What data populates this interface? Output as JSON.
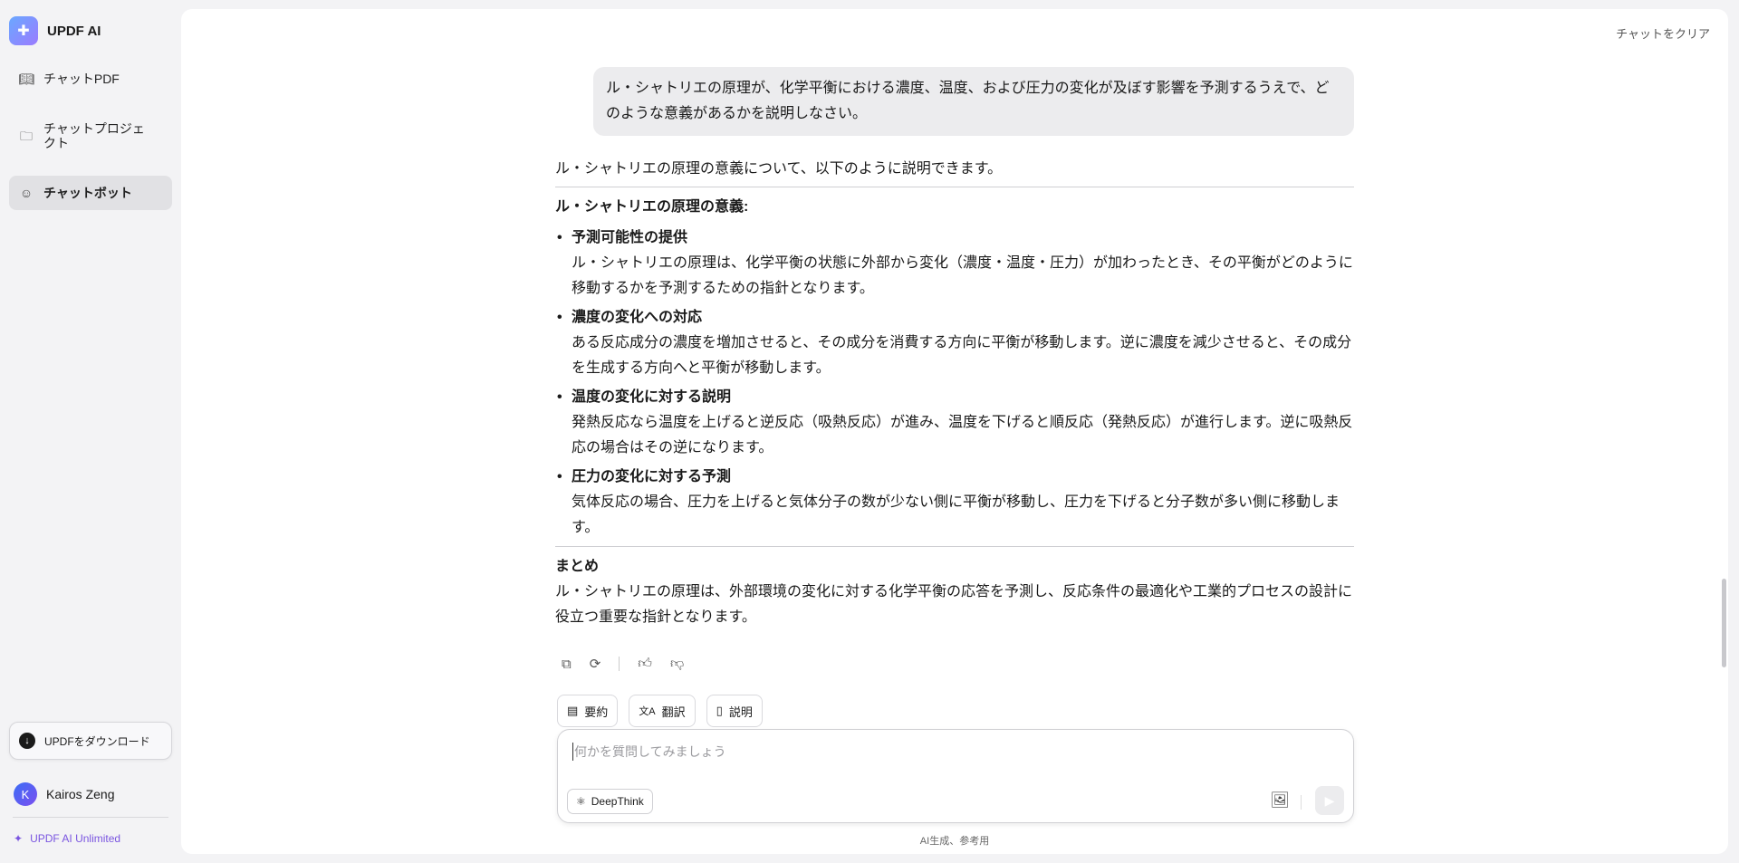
{
  "app": {
    "name": "UPDF AI"
  },
  "sidebar": {
    "items": [
      {
        "label": "チャットPDF",
        "icon": "book-icon"
      },
      {
        "label": "チャットプロジェクト",
        "icon": "folder-icon"
      },
      {
        "label": "チャットボット",
        "icon": "bot-icon"
      }
    ],
    "download_label": "UPDFをダウンロード",
    "user": {
      "initial": "K",
      "name": "Kairos Zeng"
    },
    "plan": "UPDF AI Unlimited"
  },
  "header": {
    "clear_label": "チャットをクリア"
  },
  "chat": {
    "user_message": "ル・シャトリエの原理が、化学平衡における濃度、温度、および圧力の変化が及ぼす影響を予測するうえで、どのような意義があるかを説明しなさい。",
    "intro": "ル・シャトリエの原理の意義について、以下のように説明できます。",
    "heading": "ル・シャトリエの原理の意義:",
    "points": [
      {
        "title": "予測可能性の提供",
        "body": "ル・シャトリエの原理は、化学平衡の状態に外部から変化（濃度・温度・圧力）が加わったとき、その平衡がどのように移動するかを予測するための指針となります。"
      },
      {
        "title": "濃度の変化への対応",
        "body": "ある反応成分の濃度を増加させると、その成分を消費する方向に平衡が移動します。逆に濃度を減少させると、その成分を生成する方向へと平衡が移動します。"
      },
      {
        "title": "温度の変化に対する説明",
        "body": "発熱反応なら温度を上げると逆反応（吸熱反応）が進み、温度を下げると順反応（発熱反応）が進行します。逆に吸熱反応の場合はその逆になります。"
      },
      {
        "title": "圧力の変化に対する予測",
        "body": "気体反応の場合、圧力を上げると気体分子の数が少ない側に平衡が移動し、圧力を下げると分子数が多い側に移動します。"
      }
    ],
    "summary_title": "まとめ",
    "summary": "ル・シャトリエの原理は、外部環境の変化に対する化学平衡の応答を予測し、反応条件の最適化や工業的プロセスの設計に役立つ重要な指針となります。"
  },
  "quick_actions": [
    {
      "label": "要約"
    },
    {
      "label": "翻訳"
    },
    {
      "label": "説明"
    }
  ],
  "input": {
    "placeholder": "何かを質問してみましょう",
    "deepthink_label": "DeepThink"
  },
  "footer": "AI生成、参考用"
}
